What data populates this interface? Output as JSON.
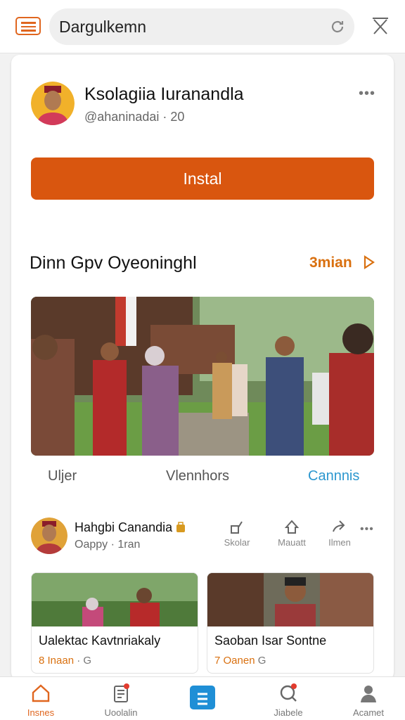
{
  "search": {
    "value": "Dargulkemn",
    "placeholder": ""
  },
  "profile": {
    "name": "Ksolagiia Iuranandla",
    "handle": "@ahaninadai · 20",
    "more": "•••"
  },
  "install_label": "Instal",
  "section": {
    "title": "Dinn Gpv Oyeoninghl",
    "link": "3mian"
  },
  "tabs": [
    {
      "label": "Uljer"
    },
    {
      "label": "Vlennhors"
    },
    {
      "label": "Cannnis"
    }
  ],
  "post": {
    "name": "Hahgbi Canandia",
    "sub": "Oappy · 1ran",
    "more": "•••",
    "actions": [
      {
        "label": "Skolar",
        "icon": "share-icon"
      },
      {
        "label": "Mauatt",
        "icon": "save-icon"
      },
      {
        "label": "Ilmen",
        "icon": "forward-icon"
      }
    ]
  },
  "thumbs": [
    {
      "title": "Ualektac Kavtnriakaly",
      "count": "8 Inaan",
      "suffix": "· G"
    },
    {
      "title": "Saoban Isar Sontne",
      "count": "7 Oanen",
      "suffix": "G"
    }
  ],
  "bottom_nav": [
    {
      "label": "Insnes",
      "icon": "home-icon",
      "active": true
    },
    {
      "label": "Uoolalin",
      "icon": "feed-icon"
    },
    {
      "label": "",
      "icon": "app-icon"
    },
    {
      "label": "Jiabele",
      "icon": "search-icon"
    },
    {
      "label": "Acamet",
      "icon": "user-icon"
    }
  ],
  "colors": {
    "accent": "#d9560f",
    "link": "#2c97cf"
  }
}
